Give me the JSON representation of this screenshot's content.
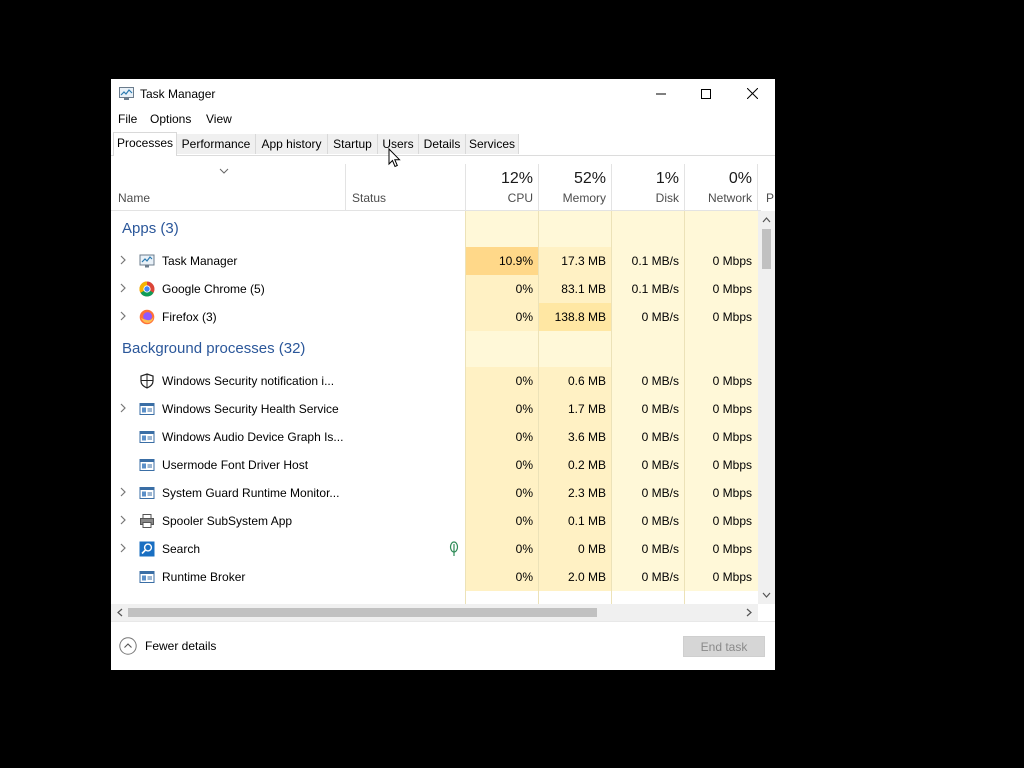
{
  "window": {
    "title": "Task Manager",
    "app_icon": "task-manager-icon"
  },
  "menu": [
    "File",
    "Options",
    "View"
  ],
  "tabs": [
    "Processes",
    "Performance",
    "App history",
    "Startup",
    "Users",
    "Details",
    "Services"
  ],
  "active_tab": "Processes",
  "columns": {
    "name": "Name",
    "status": "Status",
    "cpu": {
      "label": "CPU",
      "percent": "12%"
    },
    "memory": {
      "label": "Memory",
      "percent": "52%"
    },
    "disk": {
      "label": "Disk",
      "percent": "1%"
    },
    "network": {
      "label": "Network",
      "percent": "0%"
    },
    "power_partial": "P"
  },
  "groups": {
    "apps": "Apps (3)",
    "background": "Background processes (32)"
  },
  "apps": [
    {
      "name": "Task Manager",
      "icon": "task-manager-icon",
      "cpu": "10.9%",
      "memory": "17.3 MB",
      "disk": "0.1 MB/s",
      "network": "0 Mbps"
    },
    {
      "name": "Google Chrome (5)",
      "icon": "chrome-icon",
      "cpu": "0%",
      "memory": "83.1 MB",
      "disk": "0.1 MB/s",
      "network": "0 Mbps"
    },
    {
      "name": "Firefox (3)",
      "icon": "firefox-icon",
      "cpu": "0%",
      "memory": "138.8 MB",
      "disk": "0 MB/s",
      "network": "0 Mbps"
    }
  ],
  "background": [
    {
      "name": "Windows Security notification i...",
      "icon": "shield-icon",
      "cpu": "0%",
      "memory": "0.6 MB",
      "disk": "0 MB/s",
      "network": "0 Mbps"
    },
    {
      "name": "Windows Security Health Service",
      "icon": "service-window-icon",
      "cpu": "0%",
      "memory": "1.7 MB",
      "disk": "0 MB/s",
      "network": "0 Mbps"
    },
    {
      "name": "Windows Audio Device Graph Is...",
      "icon": "service-window-icon",
      "cpu": "0%",
      "memory": "3.6 MB",
      "disk": "0 MB/s",
      "network": "0 Mbps"
    },
    {
      "name": "Usermode Font Driver Host",
      "icon": "service-window-icon",
      "cpu": "0%",
      "memory": "0.2 MB",
      "disk": "0 MB/s",
      "network": "0 Mbps"
    },
    {
      "name": "System Guard Runtime Monitor...",
      "icon": "service-window-icon",
      "cpu": "0%",
      "memory": "2.3 MB",
      "disk": "0 MB/s",
      "network": "0 Mbps"
    },
    {
      "name": "Spooler SubSystem App",
      "icon": "printer-icon",
      "cpu": "0%",
      "memory": "0.1 MB",
      "disk": "0 MB/s",
      "network": "0 Mbps"
    },
    {
      "name": "Search",
      "icon": "search-icon",
      "status_icon": "leaf-icon",
      "cpu": "0%",
      "memory": "0 MB",
      "disk": "0 MB/s",
      "network": "0 Mbps"
    },
    {
      "name": "Runtime Broker",
      "icon": "service-window-icon",
      "cpu": "0%",
      "memory": "2.0 MB",
      "disk": "0 MB/s",
      "network": "0 Mbps"
    }
  ],
  "footer": {
    "fewer_details": "Fewer details",
    "end_task": "End task"
  },
  "colors": {
    "heat_light": "#fff8d8",
    "heat_mid": "#fff1c4",
    "heat_strong": "#ffe7a3",
    "heat_cpu_high": "#ffd889",
    "group_text": "#2b579a"
  }
}
